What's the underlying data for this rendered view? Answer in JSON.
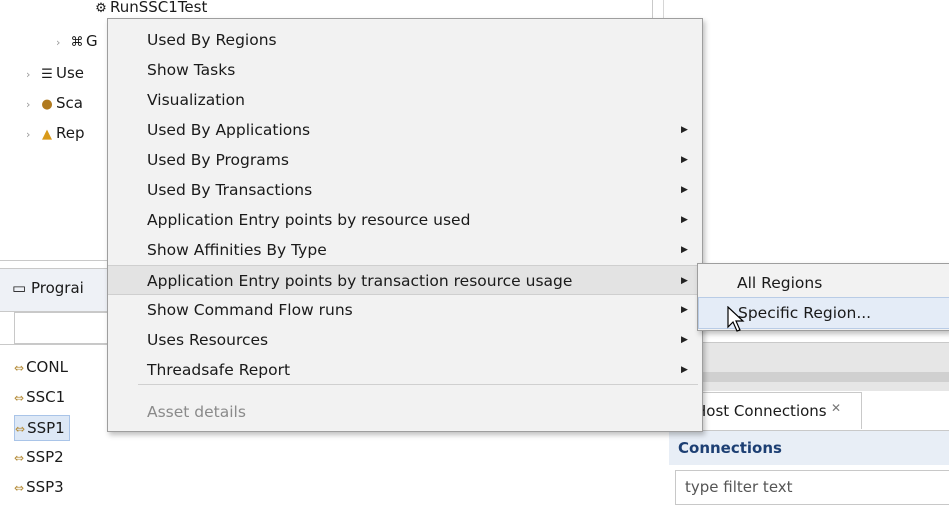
{
  "tree": {
    "items": [
      {
        "label": "RunSSC1Test",
        "icon": "gear-icon"
      },
      {
        "label": "G",
        "icon": "tree-icon"
      },
      {
        "label": "Use",
        "icon": "list-icon"
      },
      {
        "label": "Sca",
        "icon": "scan-icon"
      },
      {
        "label": "Rep",
        "icon": "report-icon"
      }
    ]
  },
  "programs_panel": {
    "title": "Prograi",
    "items": [
      "CONL",
      "SSC1",
      "SSP1",
      "SSP2",
      "SSP3"
    ],
    "selected": "SSP1"
  },
  "context_menu": {
    "items": [
      {
        "label": "Used By Regions",
        "submenu": false
      },
      {
        "label": "Show Tasks",
        "submenu": false
      },
      {
        "label": "Visualization",
        "submenu": false
      },
      {
        "label": "Used By Applications",
        "submenu": true
      },
      {
        "label": "Used By Programs",
        "submenu": true
      },
      {
        "label": "Used By Transactions",
        "submenu": true
      },
      {
        "label": "Application Entry points by resource used",
        "submenu": true
      },
      {
        "label": "Show Affinities By Type",
        "submenu": true
      },
      {
        "label": "Application Entry points by transaction resource usage",
        "submenu": true,
        "active": true
      },
      {
        "label": "Show Command Flow runs",
        "submenu": true
      },
      {
        "label": "Uses Resources",
        "submenu": true
      },
      {
        "label": "Threadsafe Report",
        "submenu": true
      },
      {
        "label": "Asset details",
        "submenu": false,
        "disabled": true
      }
    ]
  },
  "submenu": {
    "items": [
      {
        "label": "All Regions"
      },
      {
        "label": "Specific Region...",
        "active": true
      }
    ]
  },
  "host_connections": {
    "tab_label": "Host Connections",
    "close_glyph": "✕",
    "section_title": "Connections",
    "filter_placeholder": "type filter text"
  },
  "colors": {
    "menu_bg": "#f2f2f2",
    "highlight": "#e4ecf7",
    "connections_title": "#1d3f73"
  }
}
